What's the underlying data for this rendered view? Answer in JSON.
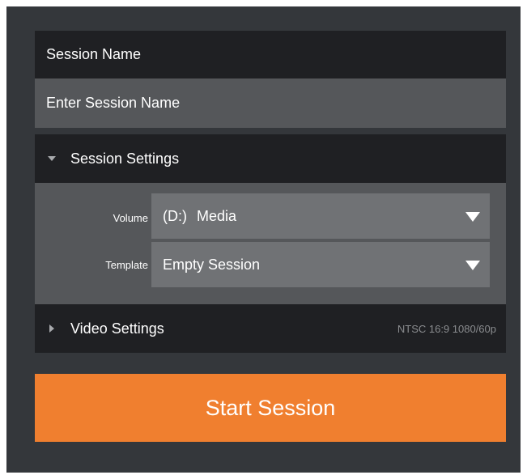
{
  "session_name": {
    "label": "Session Name",
    "placeholder": "Enter Session Name",
    "value": ""
  },
  "session_settings": {
    "title": "Session Settings",
    "expanded": true,
    "volume": {
      "label": "Volume",
      "drive": "(D:)",
      "name": "Media"
    },
    "template": {
      "label": "Template",
      "value": "Empty Session"
    }
  },
  "video_settings": {
    "title": "Video Settings",
    "expanded": false,
    "summary": "NTSC 16:9 1080/60p"
  },
  "start_button": {
    "label": "Start Session"
  },
  "colors": {
    "panel_bg": "#34373b",
    "header_bg": "#1f2023",
    "input_bg": "#55575a",
    "dropdown_bg": "#707275",
    "accent": "#f07f2f"
  },
  "icons": {
    "expanded_section": "chevron-down-icon",
    "collapsed_section": "chevron-right-icon",
    "dropdown": "caret-down-icon"
  }
}
